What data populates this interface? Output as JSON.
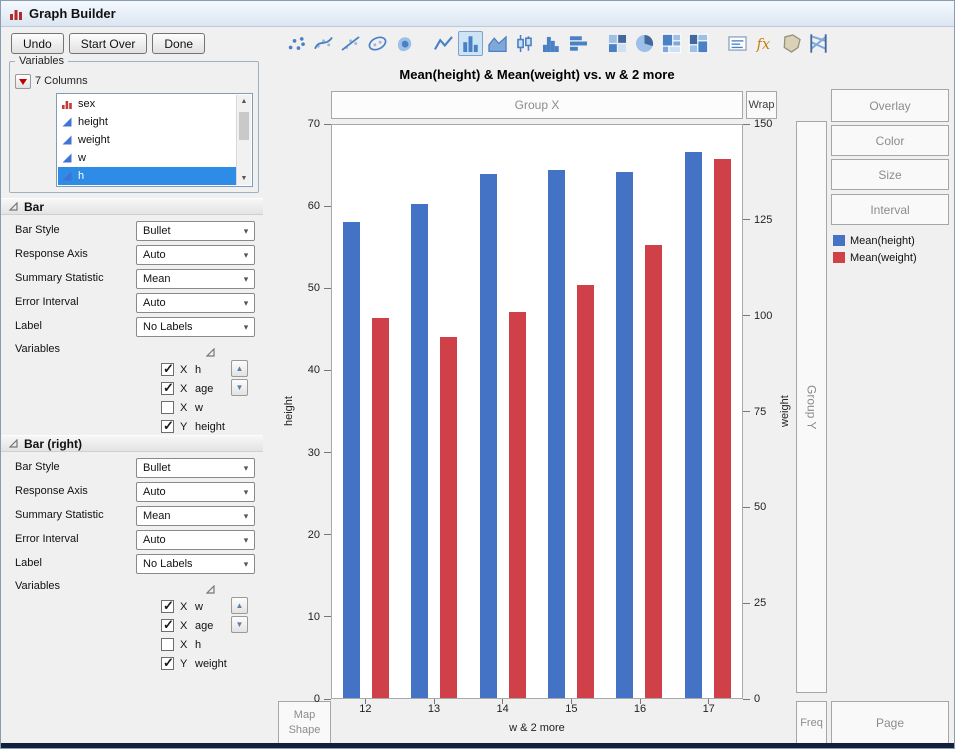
{
  "window": {
    "title": "Graph Builder"
  },
  "toolbar": {
    "buttons": [
      {
        "label": "Undo"
      },
      {
        "label": "Start Over"
      },
      {
        "label": "Done"
      }
    ]
  },
  "palette": {
    "groups": [
      [
        {
          "name": "points"
        },
        {
          "name": "smoother"
        },
        {
          "name": "line-of-fit"
        },
        {
          "name": "ellipse"
        },
        {
          "name": "contour"
        }
      ],
      [
        {
          "name": "line"
        },
        {
          "name": "bar",
          "selected": true
        },
        {
          "name": "area"
        },
        {
          "name": "box-plot"
        },
        {
          "name": "histogram"
        },
        {
          "name": "bar-h"
        }
      ],
      [
        {
          "name": "heatmap"
        },
        {
          "name": "pie"
        },
        {
          "name": "treemap"
        },
        {
          "name": "mosaic"
        }
      ],
      [
        {
          "name": "caption-box"
        },
        {
          "name": "formula"
        },
        {
          "name": "map-shape"
        },
        {
          "name": "parallel-plot"
        }
      ]
    ]
  },
  "variables_panel": {
    "title": "Variables",
    "columns_label": "7 Columns",
    "items": [
      {
        "label": "sex",
        "type": "nominal"
      },
      {
        "label": "height",
        "type": "continuous"
      },
      {
        "label": "weight",
        "type": "continuous"
      },
      {
        "label": "w",
        "type": "continuous"
      },
      {
        "label": "h",
        "type": "continuous",
        "selected": true
      }
    ]
  },
  "bar_panels": [
    {
      "title": "Bar",
      "fields": [
        {
          "label": "Bar Style",
          "value": "Bullet"
        },
        {
          "label": "Response Axis",
          "value": "Auto"
        },
        {
          "label": "Summary Statistic",
          "value": "Mean"
        },
        {
          "label": "Error Interval",
          "value": "Auto"
        },
        {
          "label": "Label",
          "value": "No Labels"
        }
      ],
      "variables_label": "Variables",
      "variables": [
        {
          "checked": true,
          "role": "X",
          "name": "h"
        },
        {
          "checked": true,
          "role": "X",
          "name": "age"
        },
        {
          "checked": false,
          "role": "X",
          "name": "w"
        },
        {
          "checked": true,
          "role": "Y",
          "name": "height"
        }
      ]
    },
    {
      "title": "Bar (right)",
      "fields": [
        {
          "label": "Bar Style",
          "value": "Bullet"
        },
        {
          "label": "Response Axis",
          "value": "Auto"
        },
        {
          "label": "Summary Statistic",
          "value": "Mean"
        },
        {
          "label": "Error Interval",
          "value": "Auto"
        },
        {
          "label": "Label",
          "value": "No Labels"
        }
      ],
      "variables_label": "Variables",
      "variables": [
        {
          "checked": true,
          "role": "X",
          "name": "w"
        },
        {
          "checked": true,
          "role": "X",
          "name": "age"
        },
        {
          "checked": false,
          "role": "X",
          "name": "h"
        },
        {
          "checked": true,
          "role": "Y",
          "name": "weight"
        }
      ]
    }
  ],
  "zones": {
    "group_x": "Group X",
    "wrap": "Wrap",
    "overlay": "Overlay",
    "color": "Color",
    "size": "Size",
    "interval": "Interval",
    "group_y": "Group Y",
    "freq": "Freq",
    "page": "Page",
    "map_shape": "Map Shape"
  },
  "legend": {
    "items": [
      {
        "label": "Mean(height)",
        "color": "#4472c4"
      },
      {
        "label": "Mean(weight)",
        "color": "#cf4048"
      }
    ]
  },
  "chart_data": {
    "type": "bar",
    "title": "Mean(height) & Mean(weight) vs. w & 2 more",
    "categories": [
      "12",
      "13",
      "14",
      "15",
      "16",
      "17"
    ],
    "series": [
      {
        "name": "Mean(height)",
        "axis": "left",
        "color": "#4472c4",
        "values": [
          58.1,
          60.3,
          64.0,
          64.5,
          64.3,
          66.7
        ]
      },
      {
        "name": "Mean(weight)",
        "axis": "right",
        "color": "#cf4048",
        "values": [
          99.5,
          94.5,
          101.0,
          108.0,
          118.5,
          141.0
        ]
      }
    ],
    "left_axis": {
      "label": "height",
      "min": 0,
      "max": 70,
      "ticks": [
        0,
        10,
        20,
        30,
        40,
        50,
        60,
        70
      ]
    },
    "right_axis": {
      "label": "weight",
      "min": 0,
      "max": 150,
      "ticks": [
        0,
        25,
        50,
        75,
        100,
        125,
        150
      ]
    },
    "xlabel": "w & 2 more",
    "grid": false,
    "legend_position": "right"
  }
}
